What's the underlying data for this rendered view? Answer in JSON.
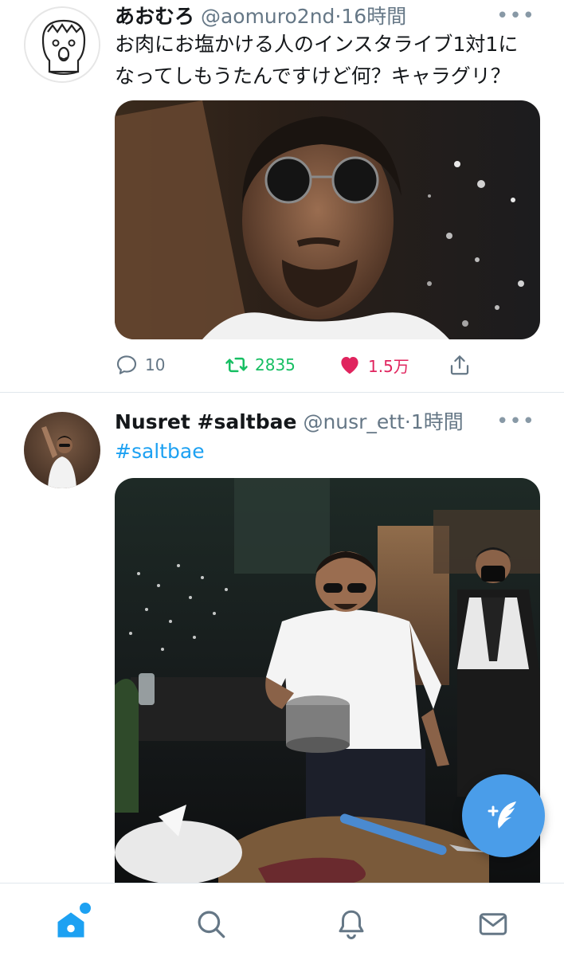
{
  "colors": {
    "accent": "#1da1f2",
    "retweet_green": "#17bf63",
    "like_red": "#e0245e",
    "secondary_text": "#657786",
    "fab": "#4a9de9"
  },
  "tweets": [
    {
      "display_name": "あおむろ",
      "handle": "@aomuro2nd",
      "time": "16時間",
      "text_line1": "お肉にお塩かける人のインスタライブ1対1に",
      "text_line2": "なってしもうたんですけど何？キャラグリ？",
      "replies": "10",
      "retweets": "2835",
      "likes": "1.5万",
      "liked": true
    },
    {
      "display_name": "Nusret #saltbae",
      "handle": "@nusr_ett",
      "time": "1時間",
      "hashtag": "#saltbae"
    }
  ],
  "tab_bar": {
    "items": [
      "home-icon",
      "search-icon",
      "notifications-icon",
      "messages-icon"
    ],
    "active": "home-icon"
  },
  "fab": {
    "icon": "compose-tweet-icon"
  }
}
